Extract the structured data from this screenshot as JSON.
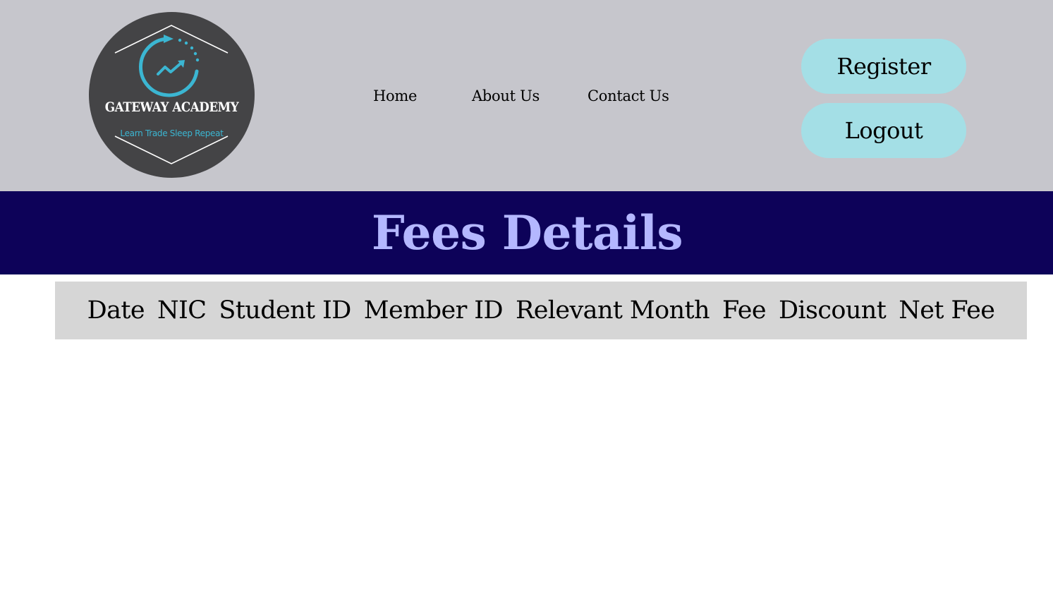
{
  "header": {
    "logo": {
      "title": "GATEWAY ACADEMY",
      "tagline": "Learn Trade Sleep Repeat",
      "icon": "circular-arrow-trend-icon",
      "colors": {
        "background": "#444446",
        "accent": "#3bb6d2"
      }
    },
    "nav": {
      "home": "Home",
      "about": "About Us",
      "contact": "Contact Us"
    },
    "buttons": {
      "register": "Register",
      "logout": "Logout"
    }
  },
  "banner": {
    "title": "Fees Details"
  },
  "table": {
    "columns": [
      "Date",
      "NIC",
      "Student ID",
      "Member ID",
      "Relevant Month",
      "Fee",
      "Discount",
      "Net Fee"
    ],
    "rows": []
  },
  "colors": {
    "header_bg": "#c6c6cc",
    "banner_bg": "#0d0259",
    "banner_text": "#b4b7ff",
    "button_bg": "#a4dfe6",
    "table_head_bg": "#d6d6d6"
  }
}
